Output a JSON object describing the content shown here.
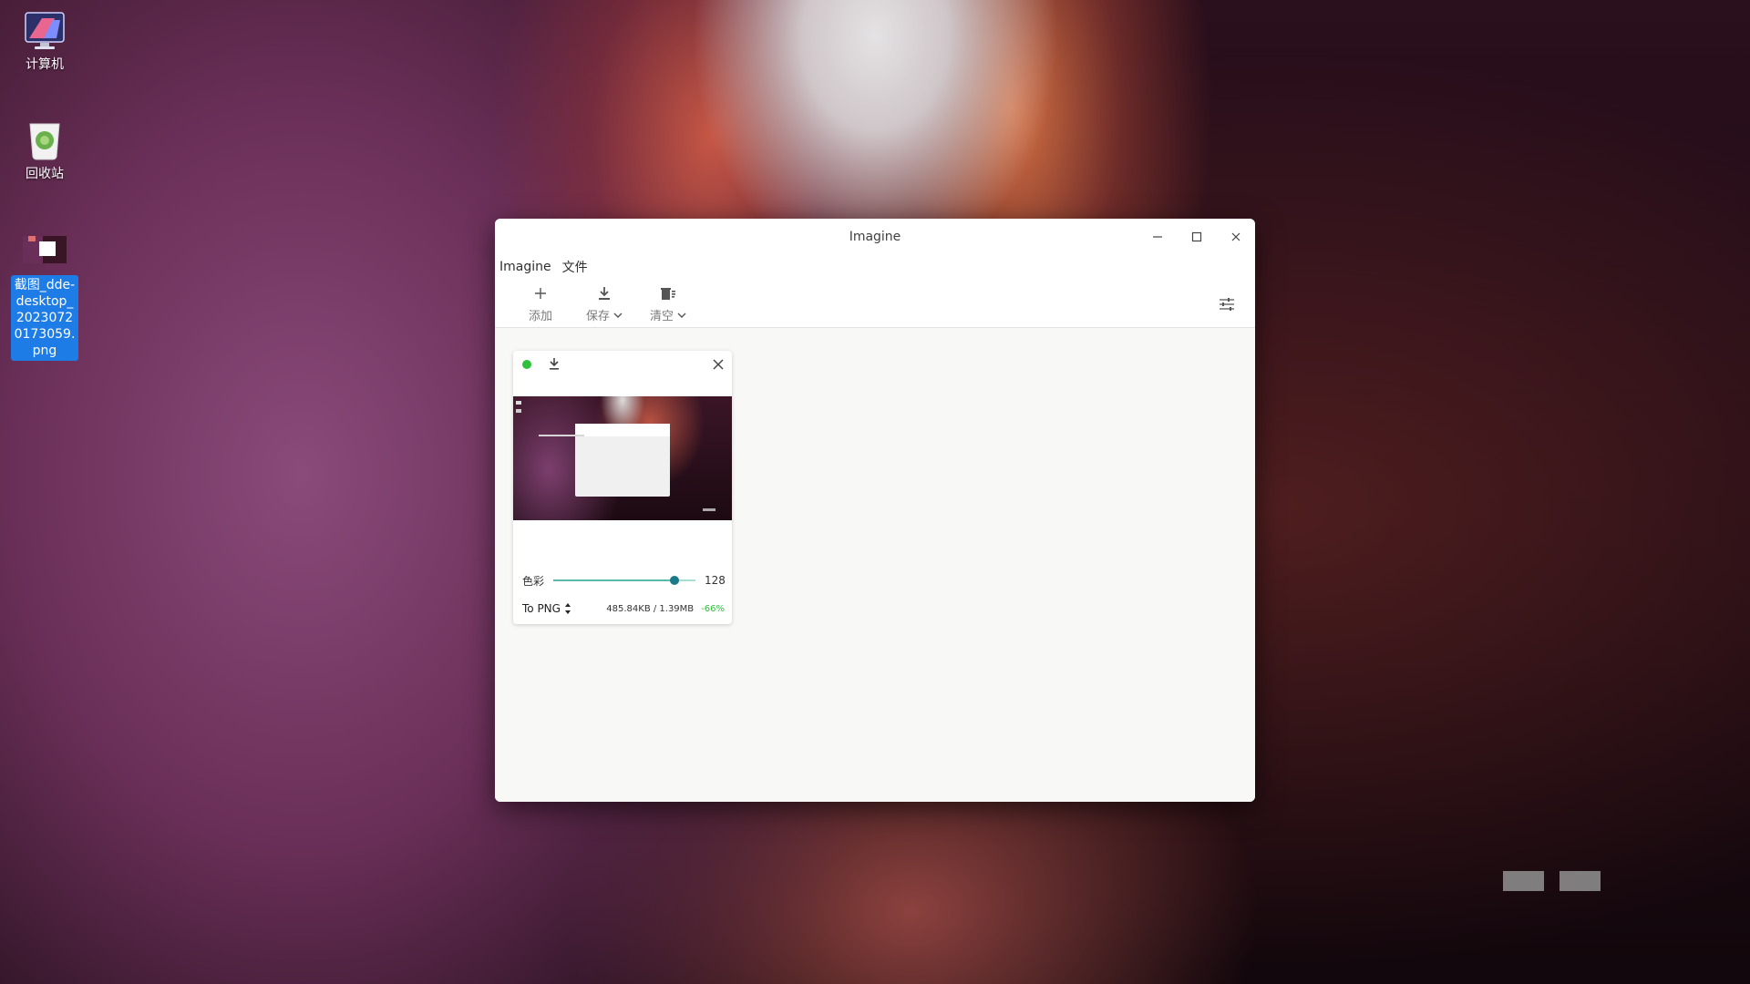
{
  "desktop": {
    "icons": [
      {
        "label": "计算机",
        "icon": "computer-icon"
      },
      {
        "label": "回收站",
        "icon": "trash-icon"
      },
      {
        "label": "截图_dde-desktop_20230720173059.png",
        "icon": "image-file-icon",
        "selected": true
      }
    ]
  },
  "window": {
    "title": "Imagine",
    "menu": [
      "Imagine",
      "文件"
    ],
    "toolbar": {
      "add_label": "添加",
      "save_label": "保存",
      "clear_label": "清空"
    },
    "card": {
      "status_color": "#2fc03c",
      "slider_label": "色彩",
      "slider_value": "128",
      "slider_fraction": 0.85,
      "format_label": "To PNG",
      "sizes": "485.84KB / 1.39MB",
      "reduction": "-66%"
    }
  },
  "colors": {
    "accent": "#1e7ce6",
    "success": "#2fc03c",
    "slider_handle": "#1a7a8a"
  }
}
